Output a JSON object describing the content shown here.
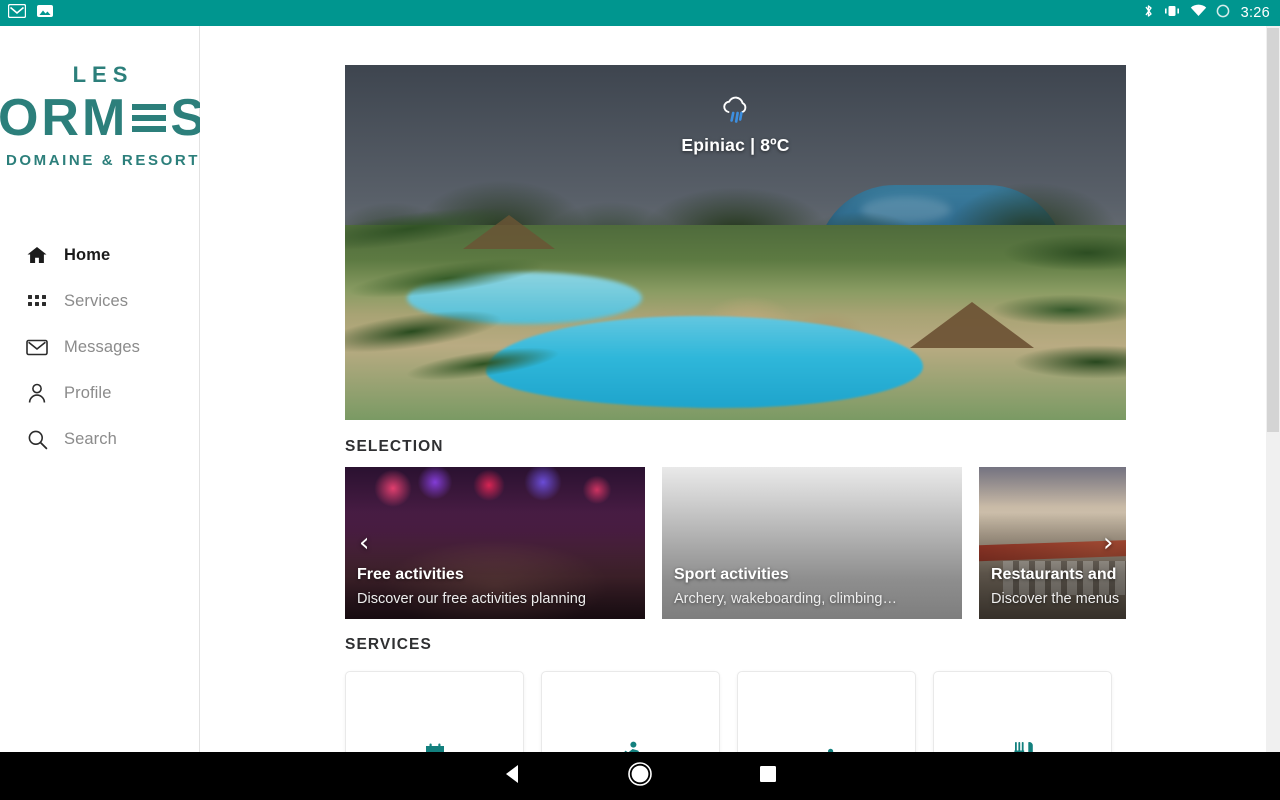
{
  "statusbar": {
    "time": "3:26",
    "left_icons": [
      "gmail-icon",
      "gallery-icon"
    ],
    "right_icons": [
      "bluetooth-icon",
      "vibrate-icon",
      "wifi-icon",
      "battery-icon"
    ]
  },
  "brand": {
    "line1": "LES",
    "line2_left": "ORM",
    "line2_right": "S",
    "line3": "DOMAINE & RESORT",
    "color": "#2c7f7b"
  },
  "sidebar": {
    "items": [
      {
        "label": "Home",
        "icon": "home-icon",
        "active": true
      },
      {
        "label": "Services",
        "icon": "grid-icon",
        "active": false
      },
      {
        "label": "Messages",
        "icon": "envelope-icon",
        "active": false
      },
      {
        "label": "Profile",
        "icon": "person-icon",
        "active": false
      },
      {
        "label": "Search",
        "icon": "search-icon",
        "active": false
      }
    ],
    "active_indicator_color": "#13807e"
  },
  "hero": {
    "weather_icon": "rain-cloud-icon",
    "weather_text": "Epiniac | 8ºC"
  },
  "selection": {
    "title": "SELECTION",
    "prev_arrow": "‹",
    "next_arrow": "›",
    "cards": [
      {
        "title": "Free activities",
        "subtitle": "Discover our free activities planning"
      },
      {
        "title": "Sport activities",
        "subtitle": "Archery, wakeboarding, climbing…"
      },
      {
        "title": "Restaurants and",
        "subtitle": "Discover the menus"
      }
    ]
  },
  "services": {
    "title": "SERVICES",
    "accent_color": "#13807e",
    "tiles": [
      {
        "icon": "calendar-icon"
      },
      {
        "icon": "running-icon"
      },
      {
        "icon": "swimmer-icon"
      },
      {
        "icon": "restaurant-icon"
      }
    ]
  },
  "navbar": {
    "back": "back-icon",
    "home": "home-circle-icon",
    "recents": "recents-square-icon"
  }
}
